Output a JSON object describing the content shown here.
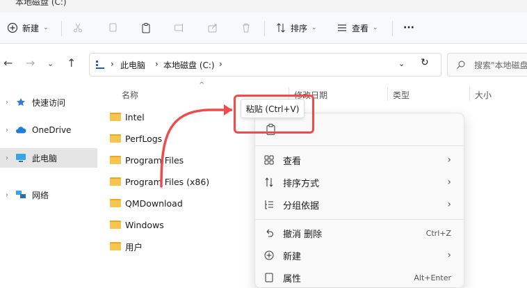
{
  "window": {
    "title": "本地磁盘 (C:)"
  },
  "toolbar": {
    "new_label": "新建",
    "sort_label": "排序",
    "view_label": "查看",
    "more_label": "···"
  },
  "address": {
    "crumbs": [
      "此电脑",
      "本地磁盘 (C:)"
    ],
    "search_placeholder": "搜索\"本地磁盘"
  },
  "sidebar": {
    "items": [
      {
        "label": "快速访问"
      },
      {
        "label": "OneDrive"
      },
      {
        "label": "此电脑"
      },
      {
        "label": "网络"
      }
    ]
  },
  "columns": [
    "名称",
    "修改日期",
    "类型",
    "大小"
  ],
  "files": [
    "Intel",
    "PerfLogs",
    "Program Files",
    "Program Files (x86)",
    "QMDownload",
    "Windows",
    "用户"
  ],
  "context_menu": {
    "items": [
      {
        "label": "查看",
        "icon": "grid-icon",
        "submenu": true
      },
      {
        "label": "排序方式",
        "icon": "sort-icon",
        "submenu": true
      },
      {
        "label": "分组依据",
        "icon": "group-icon",
        "submenu": true
      },
      {
        "label": "撤消 删除",
        "icon": "undo-icon",
        "shortcut": "Ctrl+Z"
      },
      {
        "label": "新建",
        "icon": "plus-circle-icon",
        "submenu": true
      },
      {
        "label": "属性",
        "icon": "properties-icon",
        "shortcut": "Alt+Enter"
      }
    ]
  },
  "tooltip": {
    "text": "粘贴 (Ctrl+V)"
  },
  "colors": {
    "highlight": "#ef4b4b",
    "folder": "#f5c451",
    "selected": "#e5e5e5"
  }
}
